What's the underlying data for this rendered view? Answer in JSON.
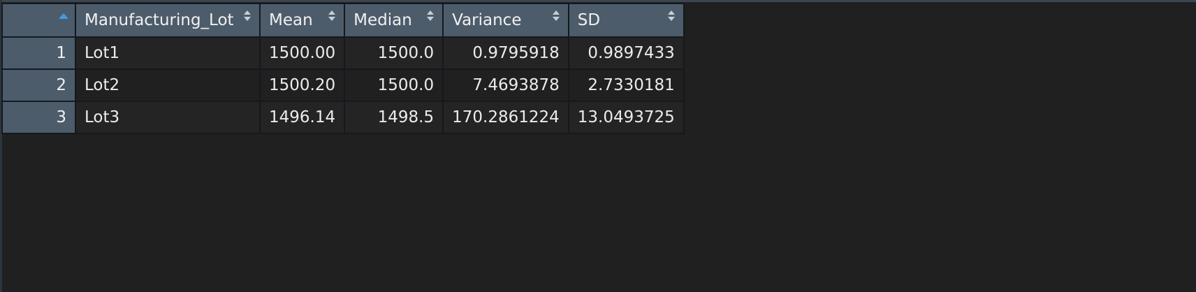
{
  "table": {
    "columns": [
      "Manufacturing_Lot",
      "Mean",
      "Median",
      "Variance",
      "SD"
    ],
    "rows": [
      {
        "rowname": "1",
        "cells": [
          "Lot1",
          "1500.00",
          "1500.0",
          "0.9795918",
          "0.9897433"
        ]
      },
      {
        "rowname": "2",
        "cells": [
          "Lot2",
          "1500.20",
          "1500.0",
          "7.4693878",
          "2.7330181"
        ]
      },
      {
        "rowname": "3",
        "cells": [
          "Lot3",
          "1496.14",
          "1498.5",
          "170.2861224",
          "13.0493725"
        ]
      }
    ]
  },
  "colors": {
    "header_bg": "#4d5c6b",
    "cell_bg": "#242424",
    "page_bg": "#202020",
    "sort_active": "#3d9ce8"
  },
  "icons": {
    "rowname_sort": "sort-ascending-icon",
    "column_sort": "sort-icon"
  }
}
